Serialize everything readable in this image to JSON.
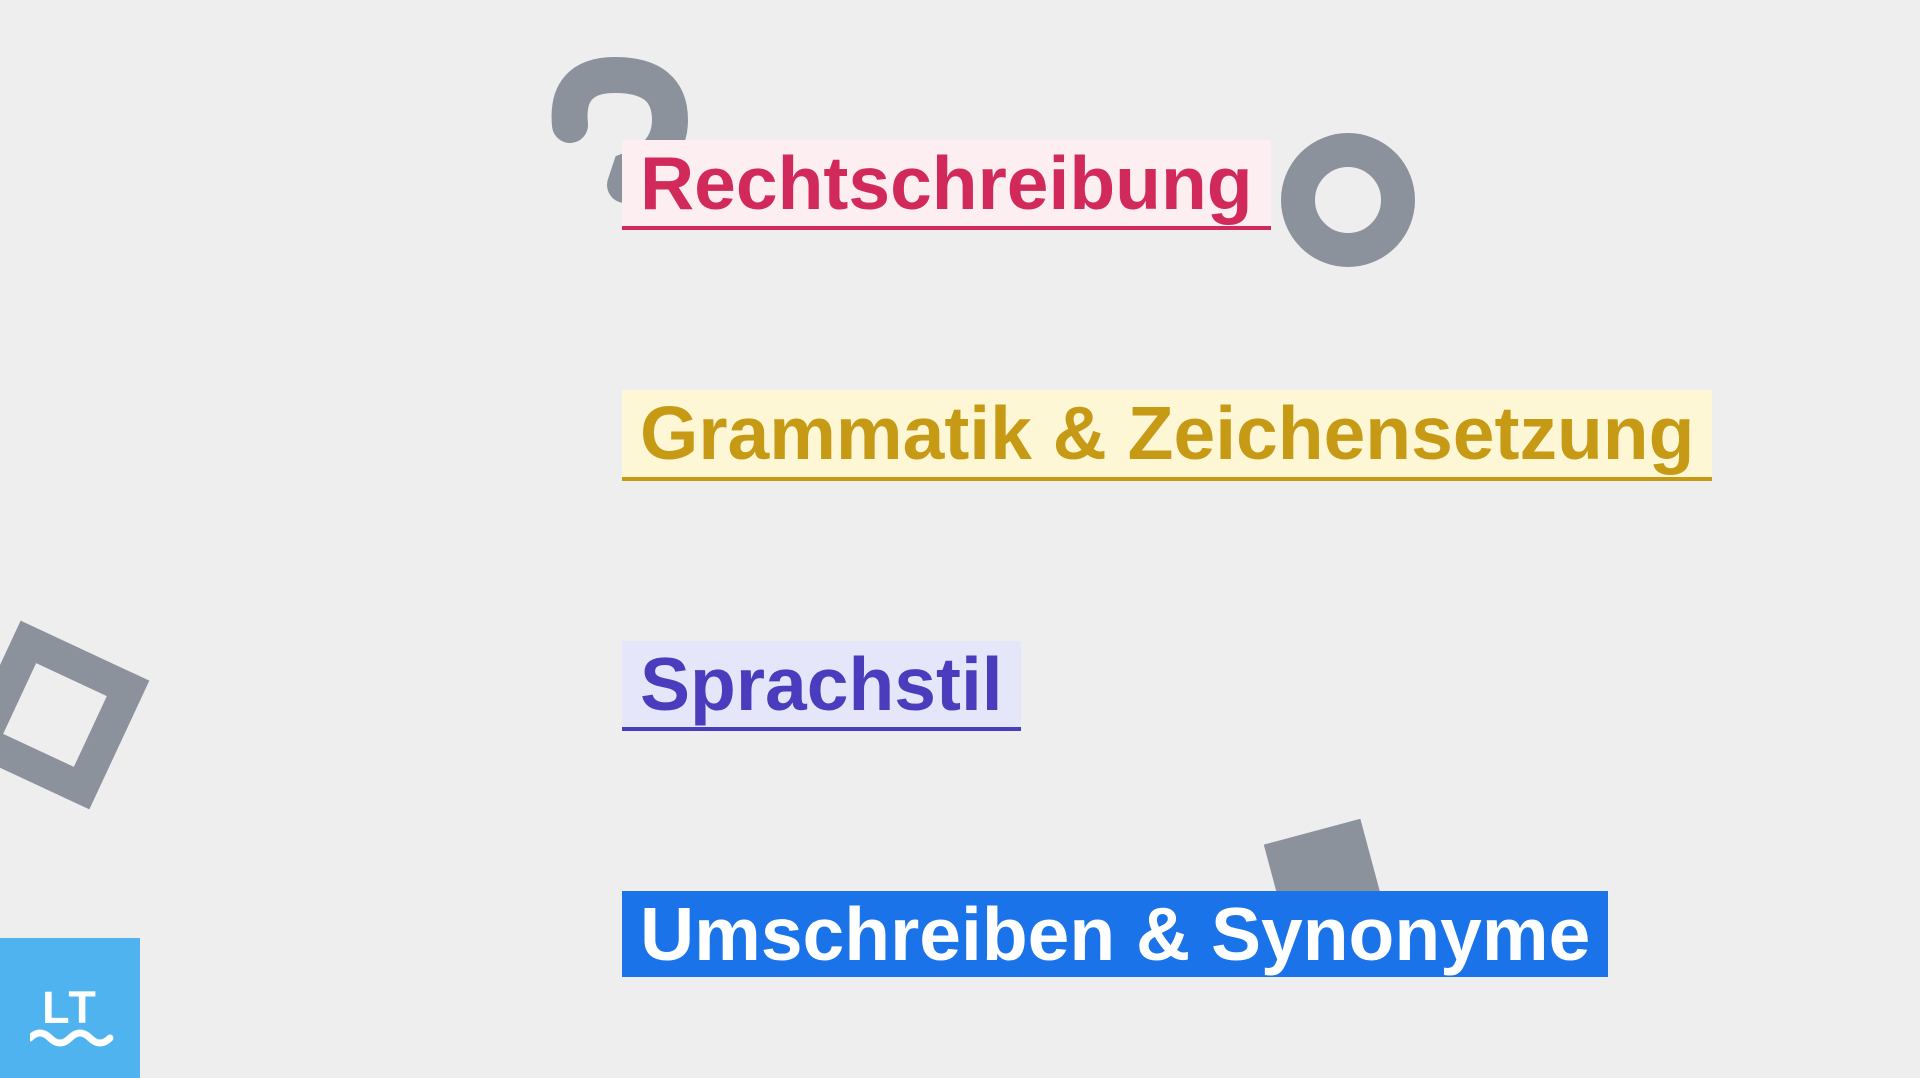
{
  "categories": {
    "spelling": "Rechtschreibung",
    "grammar": "Grammatik & Zeichensetzung",
    "style": "Sprachstil",
    "rewrite": "Umschreiben & Synonyme"
  },
  "logo": "LT",
  "colors": {
    "spelling": "#d12a5a",
    "grammar": "#c79a16",
    "style": "#4a3dbd",
    "rewrite": "#1a73e8",
    "decoration": "#8c929c",
    "logo_bg": "#4fb3f0"
  }
}
